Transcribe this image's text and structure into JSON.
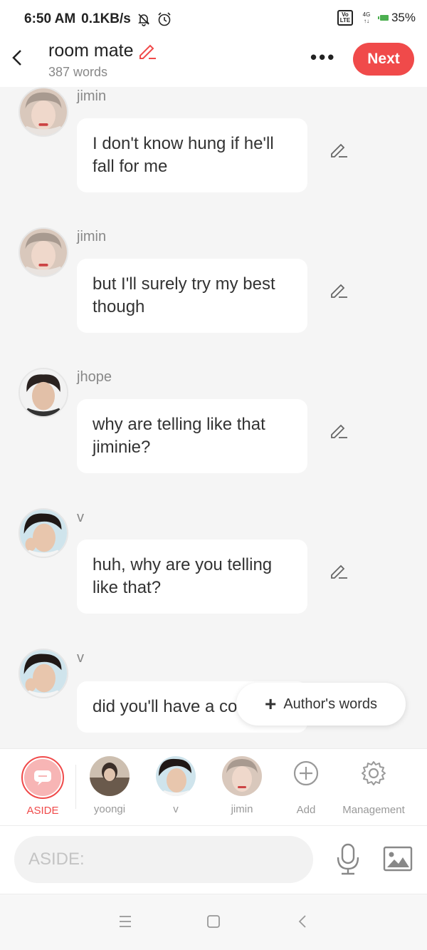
{
  "status": {
    "time": "6:50 AM",
    "speed": "0.1KB/s",
    "volte": "Vo LTE",
    "network": "4G",
    "battery": "35%"
  },
  "header": {
    "title": "room mate",
    "word_count": "387 words",
    "more": "•••",
    "next_label": "Next"
  },
  "messages": [
    {
      "name": "jimin",
      "text": "I don't know hung if he'll fall for me"
    },
    {
      "name": "jimin",
      "text": "but I'll surely try my best though"
    },
    {
      "name": "jhope",
      "text": "why are telling like that jiminie?"
    },
    {
      "name": "v",
      "text": "huh, why are you telling like that?"
    },
    {
      "name": "v",
      "text": "did you'll have a convo?"
    }
  ],
  "author_button": {
    "label": "Author's words"
  },
  "characters": {
    "aside": "ASIDE",
    "yoongi": "yoongi",
    "v": "v",
    "jimin": "jimin",
    "add": "Add",
    "management": "Management"
  },
  "input": {
    "placeholder": "ASIDE:"
  },
  "colors": {
    "accent": "#f04a4a",
    "background": "#f5f5f5",
    "bubble": "#ffffff"
  }
}
